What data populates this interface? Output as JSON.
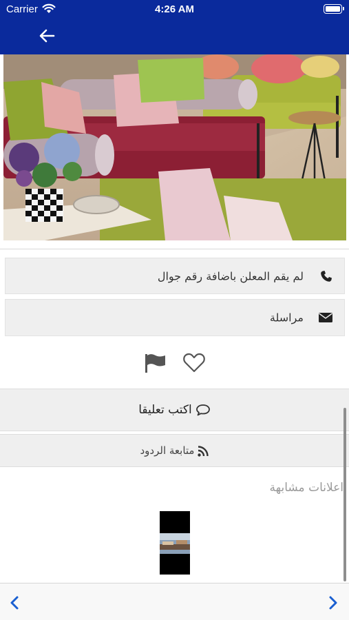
{
  "status_bar": {
    "carrier": "Carrier",
    "time": "4:26 AM"
  },
  "header": {
    "background_color": "#0a2a9c",
    "back_icon": "arrow-left-icon"
  },
  "listing": {
    "photo_description_icon": "sofa-photo",
    "contact": {
      "phone_icon": "phone-icon",
      "phone_text": "لم يقم المعلن باضافة رقم جوال",
      "message_icon": "envelope-icon",
      "message_text": "مراسلة"
    },
    "actions": {
      "report_icon": "flag-icon",
      "favorite_icon": "heart-icon"
    }
  },
  "comments": {
    "write_comment_icon": "comment-icon",
    "write_comment_label": "اكتب تعليقا",
    "follow_icon": "rss-icon",
    "follow_label": "متابعة الردود"
  },
  "similar": {
    "title": "اعلانات مشابهة"
  },
  "bottom_nav": {
    "prev_icon": "chevron-left-icon",
    "next_icon": "chevron-right-icon",
    "accent_color": "#1a5fd1"
  }
}
